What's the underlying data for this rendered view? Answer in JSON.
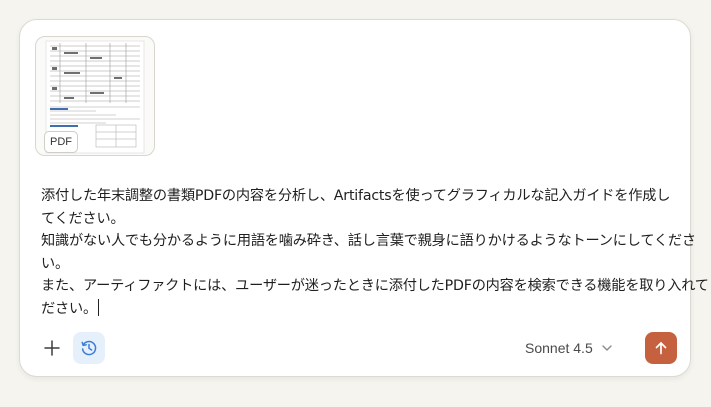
{
  "attachment": {
    "badge": "PDF",
    "icon": "pdf-thumbnail"
  },
  "prompt": {
    "lines": [
      "添付した年末調整の書類PDFの内容を分析し、Artifactsを使ってグラフィカルな記入ガイドを作成し",
      "てください。",
      "知識がない人でも分かるように用語を噛み砕き、話し言葉で親身に語りかけるようなトーンにしてくださ",
      "い。",
      "また、アーティファクトには、ユーザーが迷ったときに添付したPDFの内容を検索できる機能を取り入れてく",
      "ださい。"
    ]
  },
  "toolbar": {
    "add_icon": "plus-icon",
    "history_icon": "clock-history-icon",
    "model_label": "Sonnet 4.5",
    "model_icon": "chevron-down-icon",
    "send_icon": "arrow-up-icon"
  },
  "colors": {
    "accent": "#c6613f",
    "history_bg": "#e6f0fb",
    "history_icon": "#3b7dd8",
    "page_bg": "#f5f4ef"
  }
}
